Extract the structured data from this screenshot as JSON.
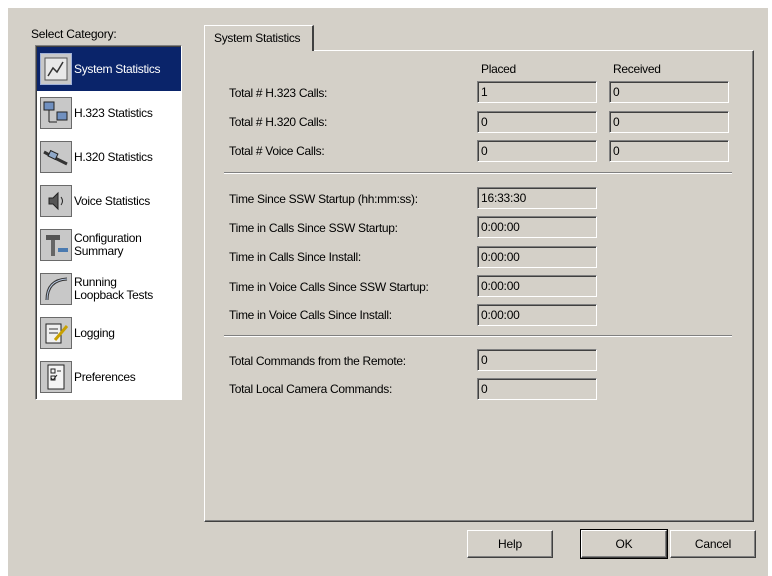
{
  "sidebar": {
    "label": "Select Category:",
    "items": [
      {
        "label": "System Statistics",
        "icon": "system-chart-icon",
        "selected": true
      },
      {
        "label": "H.323 Statistics",
        "icon": "network-computers-icon",
        "selected": false
      },
      {
        "label": "H.320 Statistics",
        "icon": "isdn-plug-icon",
        "selected": false
      },
      {
        "label": "Voice Statistics",
        "icon": "speaker-icon",
        "selected": false
      },
      {
        "label": "Configuration\nSummary",
        "icon": "tools-icon",
        "selected": false
      },
      {
        "label": "Running\nLoopback Tests",
        "icon": "loopback-icon",
        "selected": false
      },
      {
        "label": "Logging",
        "icon": "notepad-pencil-icon",
        "selected": false
      },
      {
        "label": "Preferences",
        "icon": "checklist-icon",
        "selected": false
      }
    ]
  },
  "tab": {
    "label": "System Statistics"
  },
  "calls": {
    "headers": {
      "placed": "Placed",
      "received": "Received"
    },
    "rows": [
      {
        "label": "Total # H.323 Calls:",
        "placed": "1",
        "received": "0"
      },
      {
        "label": "Total # H.320 Calls:",
        "placed": "0",
        "received": "0"
      },
      {
        "label": "Total # Voice Calls:",
        "placed": "0",
        "received": "0"
      }
    ]
  },
  "times": [
    {
      "label": "Time Since SSW Startup (hh:mm:ss):",
      "value": "16:33:30"
    },
    {
      "label": "Time in Calls Since SSW Startup:",
      "value": "0:00:00"
    },
    {
      "label": "Time in Calls Since Install:",
      "value": "0:00:00"
    },
    {
      "label": "Time in Voice Calls Since SSW Startup:",
      "value": "0:00:00"
    },
    {
      "label": "Time in Voice Calls Since Install:",
      "value": "0:00:00"
    }
  ],
  "commands": [
    {
      "label": "Total Commands from the Remote:",
      "value": "0"
    },
    {
      "label": "Total Local Camera Commands:",
      "value": "0"
    }
  ],
  "buttons": {
    "help": "Help",
    "ok": "OK",
    "cancel": "Cancel"
  },
  "colors": {
    "selection": "#0a246a",
    "face": "#d4d0c8"
  }
}
